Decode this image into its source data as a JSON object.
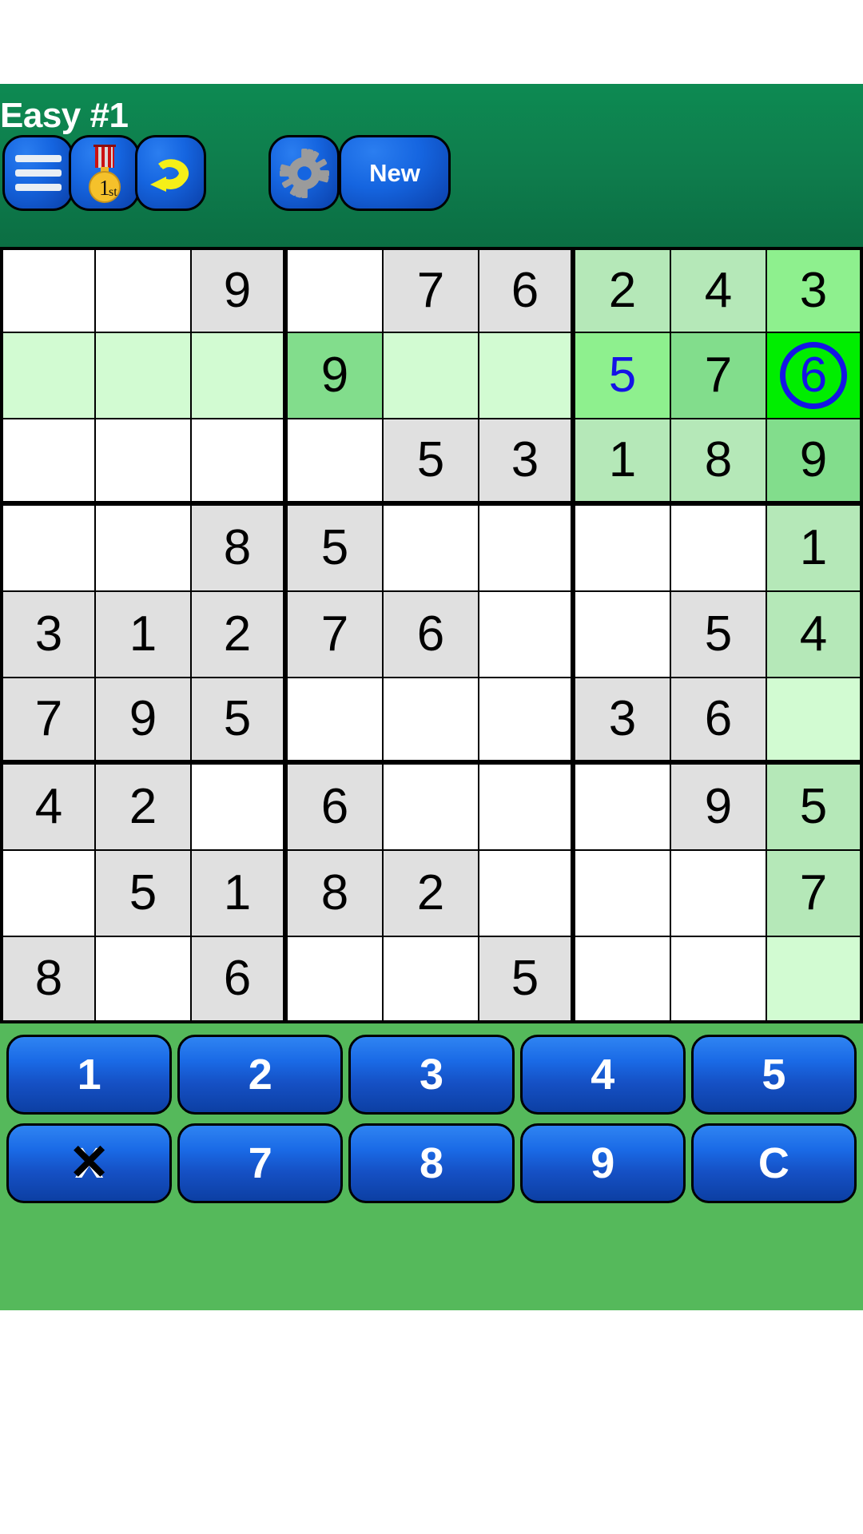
{
  "app": {
    "title": "Easy #1",
    "bar_color": "#0e7c4c",
    "keypad_bg": "#55b95b",
    "button_blue": "#1565e0",
    "selected_cell_color": "#00ee00",
    "user_value_color": "#1414e6"
  },
  "toolbar": {
    "menu_label": "menu",
    "medal_label": "1st",
    "medal_suffix": "st",
    "medal_number": "1",
    "undo_label": "undo",
    "gear_label": "settings",
    "new_label": "New"
  },
  "grid": {
    "rows": [
      [
        {
          "v": "",
          "bg": "bg-white"
        },
        {
          "v": "",
          "bg": "bg-white"
        },
        {
          "v": "9",
          "bg": "bg-grey"
        },
        {
          "v": "",
          "bg": "bg-white"
        },
        {
          "v": "7",
          "bg": "bg-grey"
        },
        {
          "v": "6",
          "bg": "bg-grey"
        },
        {
          "v": "2",
          "bg": "bg-lgreen"
        },
        {
          "v": "4",
          "bg": "bg-lgreen"
        },
        {
          "v": "3",
          "bg": "bg-green"
        }
      ],
      [
        {
          "v": "",
          "bg": "bg-pale"
        },
        {
          "v": "",
          "bg": "bg-pale"
        },
        {
          "v": "",
          "bg": "bg-pale"
        },
        {
          "v": "9",
          "bg": "bg-mgreen"
        },
        {
          "v": "",
          "bg": "bg-pale"
        },
        {
          "v": "",
          "bg": "bg-pale"
        },
        {
          "v": "5",
          "bg": "bg-green",
          "user": true
        },
        {
          "v": "7",
          "bg": "bg-mgreen"
        },
        {
          "v": "6",
          "bg": "bg-sel",
          "user": true,
          "selected": true
        }
      ],
      [
        {
          "v": "",
          "bg": "bg-white"
        },
        {
          "v": "",
          "bg": "bg-white"
        },
        {
          "v": "",
          "bg": "bg-white"
        },
        {
          "v": "",
          "bg": "bg-white"
        },
        {
          "v": "5",
          "bg": "bg-grey"
        },
        {
          "v": "3",
          "bg": "bg-grey"
        },
        {
          "v": "1",
          "bg": "bg-lgreen"
        },
        {
          "v": "8",
          "bg": "bg-lgreen"
        },
        {
          "v": "9",
          "bg": "bg-mgreen"
        }
      ],
      [
        {
          "v": "",
          "bg": "bg-white"
        },
        {
          "v": "",
          "bg": "bg-white"
        },
        {
          "v": "8",
          "bg": "bg-grey"
        },
        {
          "v": "5",
          "bg": "bg-grey"
        },
        {
          "v": "",
          "bg": "bg-white"
        },
        {
          "v": "",
          "bg": "bg-white"
        },
        {
          "v": "",
          "bg": "bg-white"
        },
        {
          "v": "",
          "bg": "bg-white"
        },
        {
          "v": "1",
          "bg": "bg-lgreen"
        }
      ],
      [
        {
          "v": "3",
          "bg": "bg-grey"
        },
        {
          "v": "1",
          "bg": "bg-grey"
        },
        {
          "v": "2",
          "bg": "bg-grey"
        },
        {
          "v": "7",
          "bg": "bg-grey"
        },
        {
          "v": "6",
          "bg": "bg-grey"
        },
        {
          "v": "",
          "bg": "bg-white"
        },
        {
          "v": "",
          "bg": "bg-white"
        },
        {
          "v": "5",
          "bg": "bg-grey"
        },
        {
          "v": "4",
          "bg": "bg-lgreen"
        }
      ],
      [
        {
          "v": "7",
          "bg": "bg-grey"
        },
        {
          "v": "9",
          "bg": "bg-grey"
        },
        {
          "v": "5",
          "bg": "bg-grey"
        },
        {
          "v": "",
          "bg": "bg-white"
        },
        {
          "v": "",
          "bg": "bg-white"
        },
        {
          "v": "",
          "bg": "bg-white"
        },
        {
          "v": "3",
          "bg": "bg-grey"
        },
        {
          "v": "6",
          "bg": "bg-grey"
        },
        {
          "v": "",
          "bg": "bg-pale"
        }
      ],
      [
        {
          "v": "4",
          "bg": "bg-grey"
        },
        {
          "v": "2",
          "bg": "bg-grey"
        },
        {
          "v": "",
          "bg": "bg-white"
        },
        {
          "v": "6",
          "bg": "bg-grey"
        },
        {
          "v": "",
          "bg": "bg-white"
        },
        {
          "v": "",
          "bg": "bg-white"
        },
        {
          "v": "",
          "bg": "bg-white"
        },
        {
          "v": "9",
          "bg": "bg-grey"
        },
        {
          "v": "5",
          "bg": "bg-lgreen"
        }
      ],
      [
        {
          "v": "",
          "bg": "bg-white"
        },
        {
          "v": "5",
          "bg": "bg-grey"
        },
        {
          "v": "1",
          "bg": "bg-grey"
        },
        {
          "v": "8",
          "bg": "bg-grey"
        },
        {
          "v": "2",
          "bg": "bg-grey"
        },
        {
          "v": "",
          "bg": "bg-white"
        },
        {
          "v": "",
          "bg": "bg-white"
        },
        {
          "v": "",
          "bg": "bg-white"
        },
        {
          "v": "7",
          "bg": "bg-lgreen"
        }
      ],
      [
        {
          "v": "8",
          "bg": "bg-grey"
        },
        {
          "v": "",
          "bg": "bg-white"
        },
        {
          "v": "6",
          "bg": "bg-grey"
        },
        {
          "v": "",
          "bg": "bg-white"
        },
        {
          "v": "",
          "bg": "bg-white"
        },
        {
          "v": "5",
          "bg": "bg-grey"
        },
        {
          "v": "",
          "bg": "bg-white"
        },
        {
          "v": "",
          "bg": "bg-white"
        },
        {
          "v": "",
          "bg": "bg-pale"
        }
      ]
    ]
  },
  "keypad": {
    "row1": [
      "1",
      "2",
      "3",
      "4",
      "5"
    ],
    "row2": [
      "X",
      "7",
      "8",
      "9",
      "C"
    ]
  }
}
